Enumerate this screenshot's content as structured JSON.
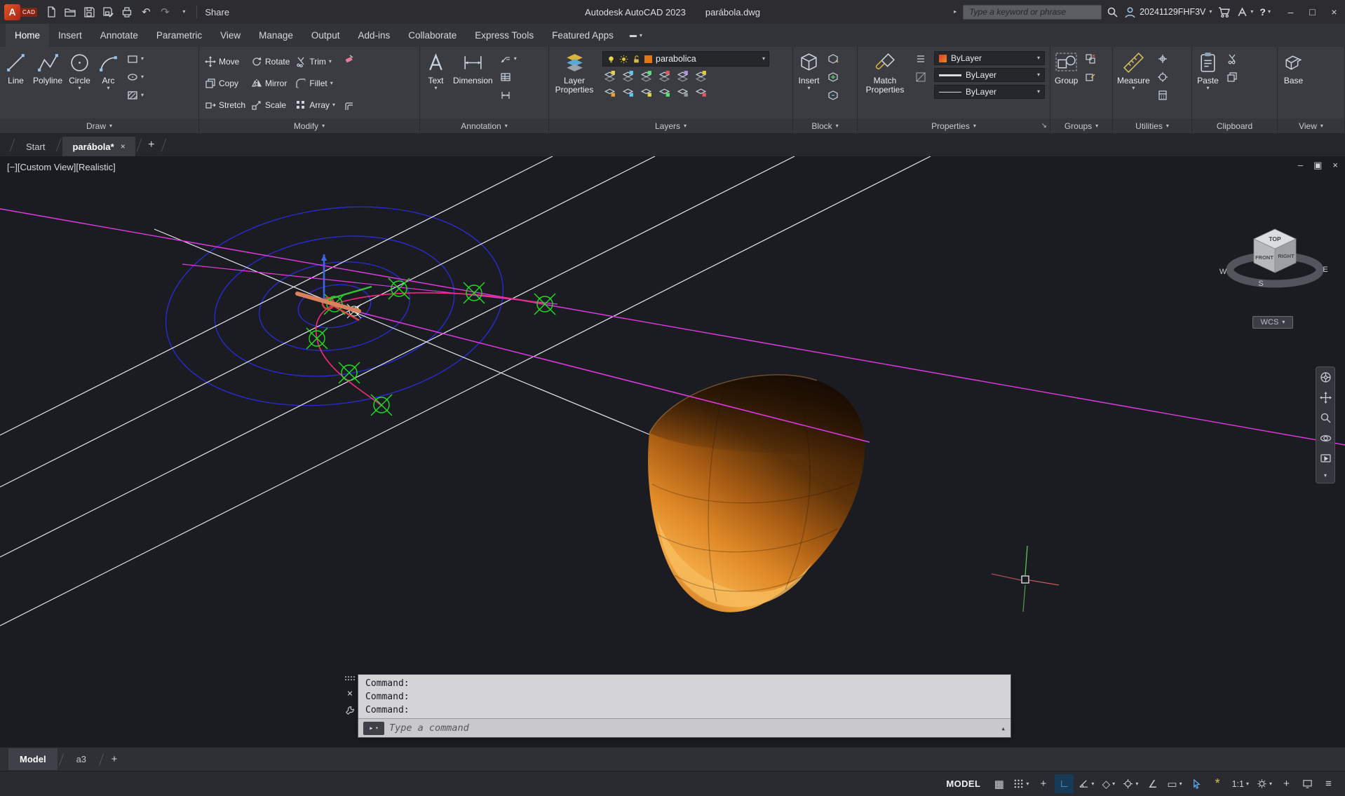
{
  "icons": {
    "chevron_down": "▾",
    "chevron_right": "▸",
    "close": "×",
    "minimize": "–",
    "maximize": "□",
    "restore": "▣",
    "help": "?",
    "undo": "↶",
    "redo": "↷",
    "expand": "▴",
    "grid": "▦",
    "plus": "+",
    "ortho": "∟",
    "isodraft": "◇",
    "osnap_angle": "∠",
    "osnap": "▭",
    "menu": "≡",
    "star": "*",
    "bar": "▬"
  },
  "title_bar": {
    "logo_a": "A",
    "logo_cad": "CAD",
    "share_label": "Share",
    "app_title": "Autodesk AutoCAD 2023",
    "doc_title": "parábola.dwg",
    "search_placeholder": "Type a keyword or phrase",
    "user_id": "20241129FHF3V"
  },
  "ribbon": {
    "tabs": [
      "Home",
      "Insert",
      "Annotate",
      "Parametric",
      "View",
      "Manage",
      "Output",
      "Add-ins",
      "Collaborate",
      "Express Tools",
      "Featured Apps"
    ],
    "panels": {
      "draw": {
        "title": "Draw",
        "tools": [
          "Line",
          "Polyline",
          "Circle",
          "Arc"
        ]
      },
      "modify": {
        "title": "Modify",
        "tools": [
          "Move",
          "Copy",
          "Stretch",
          "Rotate",
          "Mirror",
          "Scale",
          "Trim",
          "Fillet",
          "Array"
        ]
      },
      "annotation": {
        "title": "Annotation",
        "tools": [
          "Text",
          "Dimension"
        ]
      },
      "layers": {
        "title": "Layers",
        "layer_properties": "Layer Properties",
        "current_layer": "parabolica"
      },
      "block": {
        "title": "Block",
        "insert": "Insert"
      },
      "properties": {
        "title": "Properties",
        "match": "Match Properties",
        "color": "ByLayer",
        "lineweight": "ByLayer",
        "linetype": "ByLayer"
      },
      "groups": {
        "title": "Groups",
        "group": "Group"
      },
      "utilities": {
        "title": "Utilities",
        "measure": "Measure"
      },
      "clipboard": {
        "title": "Clipboard",
        "paste": "Paste"
      },
      "view": {
        "title": "View",
        "base": "Base"
      }
    }
  },
  "file_tabs": {
    "start": "Start",
    "current": "parábola*",
    "new_tab": "+"
  },
  "viewport": {
    "controls": {
      "minimize": "[−]",
      "view": "[Custom View]",
      "visual_style": "[Realistic]"
    },
    "viewcube": {
      "top": "TOP",
      "front": "FRONT",
      "right": "RIGHT",
      "west": "W",
      "south": "S",
      "east": "E",
      "wcs": "WCS"
    }
  },
  "command": {
    "history": [
      "Command:",
      "Command:",
      "Command:"
    ],
    "placeholder": "Type a command"
  },
  "layout_tabs": {
    "model": "Model",
    "a3": "a3",
    "new_tab": "+"
  },
  "status": {
    "model": "MODEL",
    "scale": "1:1"
  },
  "colors": {
    "accent_blue": "#5ab4f0",
    "layer_swatch": "#e07818",
    "solid_orange": "#d2811f",
    "magenta": "#e23ae2",
    "marker_green": "#1ee01e",
    "construction_blue": "#2b2bdd"
  }
}
